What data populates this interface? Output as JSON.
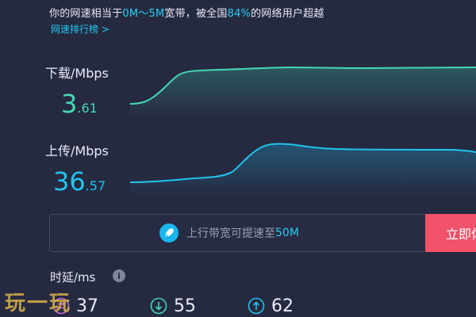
{
  "summary": {
    "prefix": "你的网速相当于",
    "bandwidth": "0M～5M",
    "middle": "宽带，被全国",
    "percent": "84%",
    "suffix": "的网络用户超越"
  },
  "rank_link": "网速排行榜 >",
  "download": {
    "label": "下载/Mbps",
    "int": "3",
    "dec": ".61",
    "color": "#44d8b3"
  },
  "upload": {
    "label": "上传/Mbps",
    "int": "36",
    "dec": ".57",
    "color": "#1fc4ee"
  },
  "promo": {
    "prefix": "上行带宽可提速至",
    "speed": "50M",
    "button": "立即体验",
    "icon": "rocket-icon"
  },
  "latency": {
    "title": "时延/ms",
    "ping": "37",
    "down": "55",
    "up": "62"
  },
  "watermark": "玩一玩"
}
